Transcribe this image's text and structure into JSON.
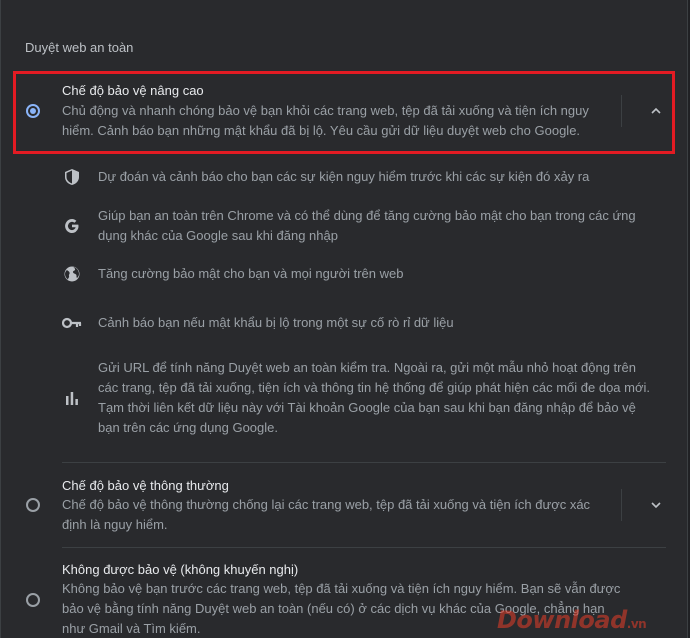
{
  "section": {
    "title": "Duyệt web an toàn"
  },
  "enhanced": {
    "title": "Chế độ bảo vệ nâng cao",
    "description": "Chủ động và nhanh chóng bảo vệ bạn khỏi các trang web, tệp đã tải xuống và tiện ích nguy hiểm. Cảnh báo bạn những mật khẩu đã bị lộ. Yêu cầu gửi dữ liệu duyệt web cho Google.",
    "selected": true,
    "expanded": true,
    "details": [
      {
        "icon": "shield-icon",
        "text": "Dự đoán và cảnh báo cho bạn các sự kiện nguy hiểm trước khi các sự kiện đó xảy ra"
      },
      {
        "icon": "google-g-icon",
        "text": "Giúp bạn an toàn trên Chrome và có thể dùng để tăng cường bảo mật cho bạn trong các ứng dụng khác của Google sau khi đăng nhập"
      },
      {
        "icon": "globe-icon",
        "text": "Tăng cường bảo mật cho bạn và mọi người trên web"
      },
      {
        "icon": "key-icon",
        "text": "Cảnh báo bạn nếu mật khẩu bị lộ trong một sự cố rò rỉ dữ liệu"
      },
      {
        "icon": "bar-chart-icon",
        "text": "Gửi URL để tính năng Duyệt web an toàn kiểm tra. Ngoài ra, gửi một mẫu nhỏ hoạt động trên các trang, tệp đã tải xuống, tiện ích và thông tin hệ thống để giúp phát hiện các mối đe dọa mới. Tạm thời liên kết dữ liệu này với Tài khoản Google của bạn sau khi bạn đăng nhập để bảo vệ bạn trên các ứng dụng Google."
      }
    ]
  },
  "standard": {
    "title": "Chế độ bảo vệ thông thường",
    "description": "Chế độ bảo vệ thông thường chống lại các trang web, tệp đã tải xuống và tiện ích được xác định là nguy hiểm.",
    "selected": false,
    "expanded": false
  },
  "none": {
    "title": "Không được bảo vệ (không khuyến nghị)",
    "description": "Không bảo vệ bạn trước các trang web, tệp đã tải xuống và tiện ích nguy hiểm. Bạn sẽ vẫn được bảo vệ bằng tính năng Duyệt web an toàn (nếu có) ở các dịch vụ khác của Google, chẳng hạn như Gmail và Tìm kiếm.",
    "selected": false
  },
  "watermark": {
    "brand": "Download",
    "suffix": ".vn"
  },
  "colors": {
    "accent": "#8ab4f8",
    "highlight": "#e31b23",
    "background": "#292a2d"
  }
}
